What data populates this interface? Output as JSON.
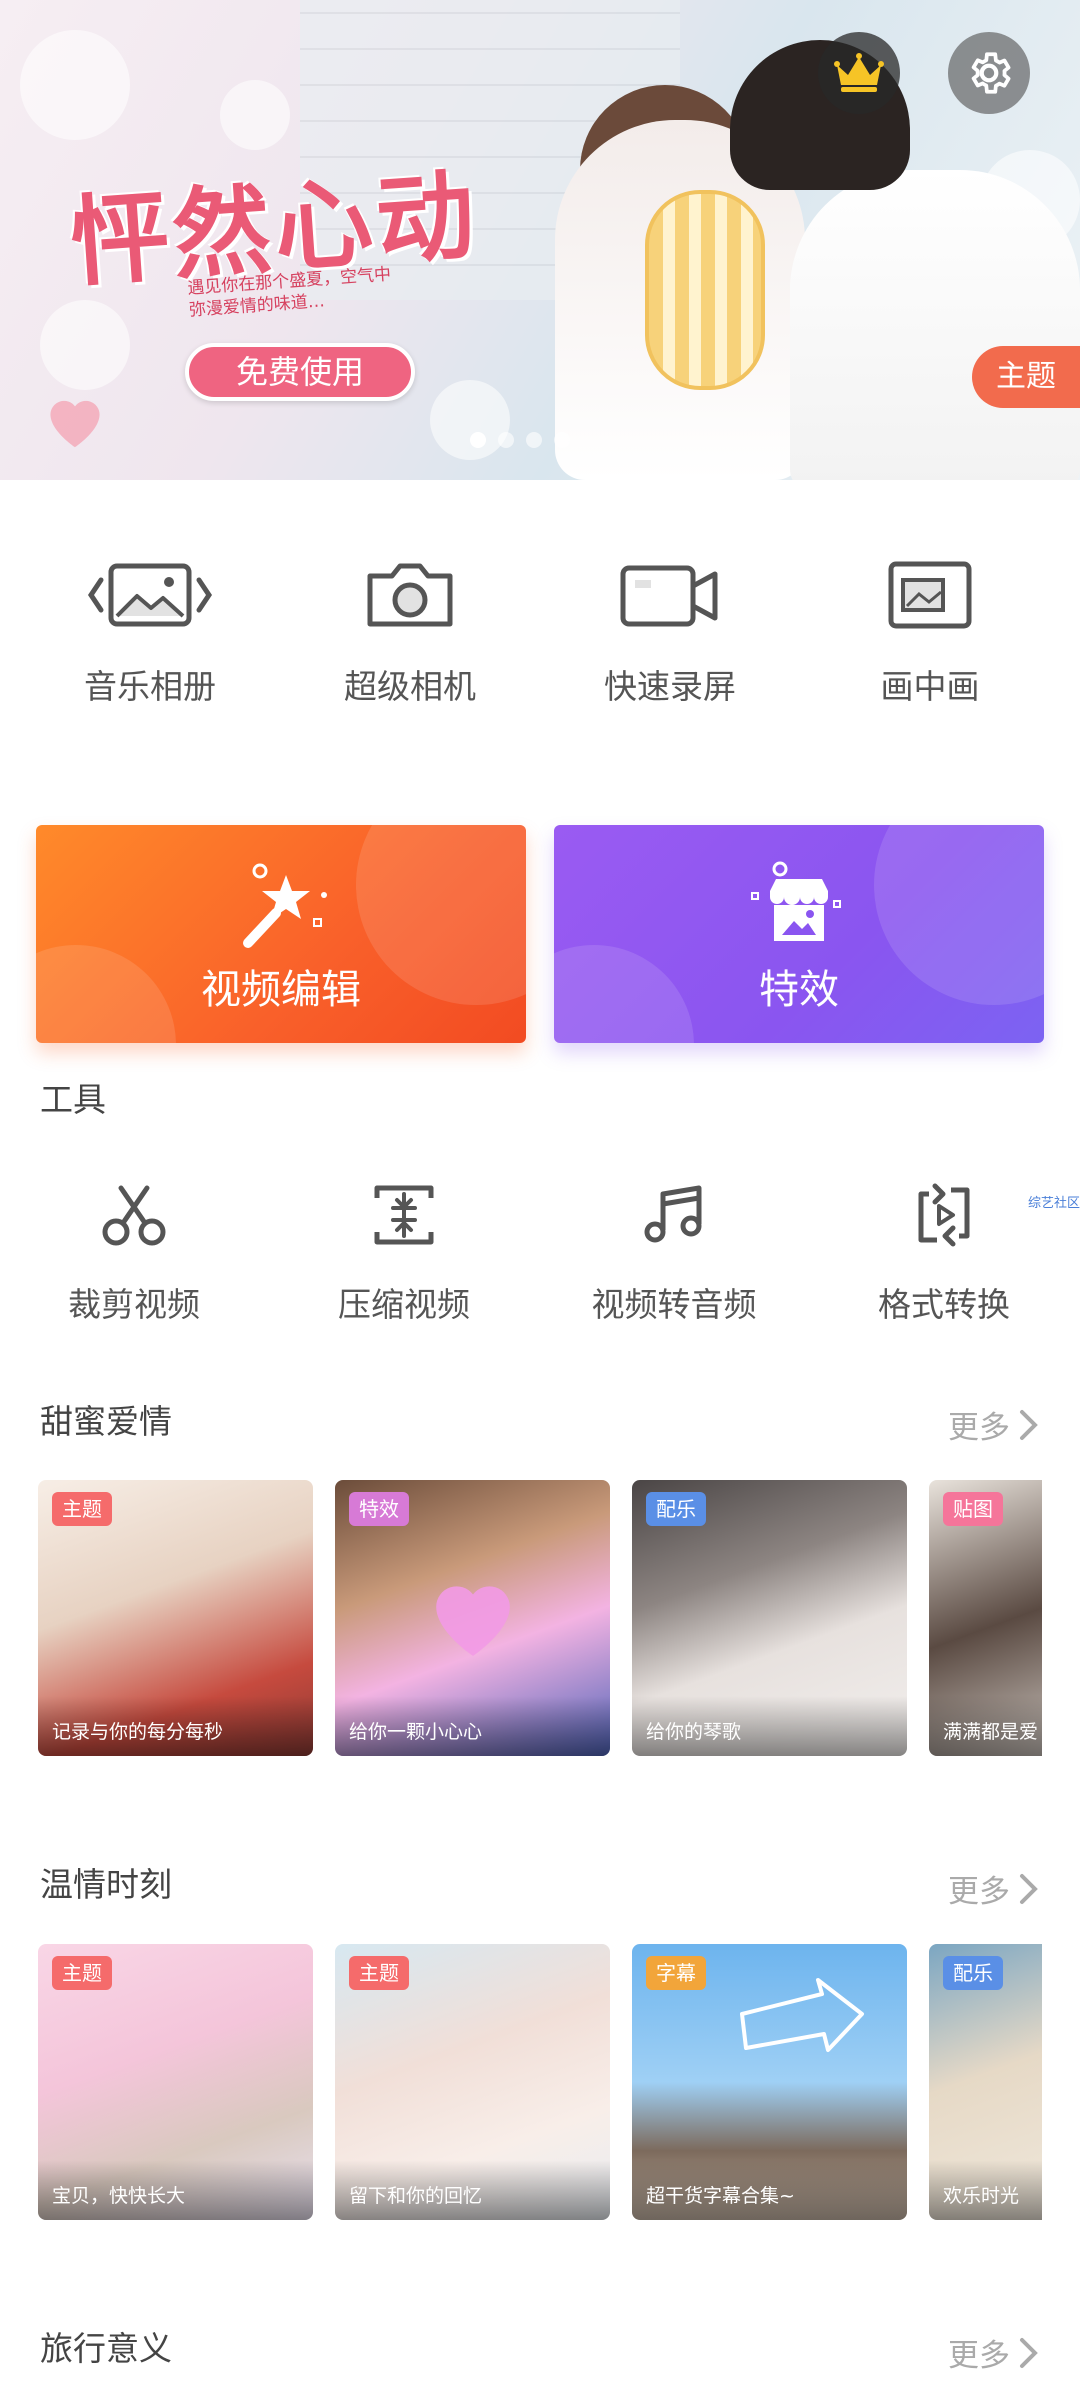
{
  "banner": {
    "title": "怦然心动",
    "subtitle": "遇见你在那个盛夏，空气中弥漫爱情的味道…",
    "free_button": "免费使用",
    "tag": "主题",
    "crown_icon": "crown-icon",
    "settings_icon": "gear-icon",
    "dots": 4,
    "active_dot": 0
  },
  "quick_tools": [
    {
      "label": "音乐相册",
      "icon": "photo-album-icon"
    },
    {
      "label": "超级相机",
      "icon": "camera-icon"
    },
    {
      "label": "快速录屏",
      "icon": "screen-record-icon"
    },
    {
      "label": "画中画",
      "icon": "picture-in-picture-icon"
    }
  ],
  "cards": [
    {
      "label": "视频编辑",
      "icon": "magic-wand-icon"
    },
    {
      "label": "特效",
      "icon": "effects-store-icon"
    }
  ],
  "tools": {
    "title": "工具",
    "items": [
      {
        "label": "裁剪视频",
        "icon": "scissors-icon"
      },
      {
        "label": "压缩视频",
        "icon": "compress-icon"
      },
      {
        "label": "视频转音频",
        "icon": "music-note-icon"
      },
      {
        "label": "格式转换",
        "icon": "convert-icon"
      }
    ],
    "watermark": "综艺社区"
  },
  "sections": [
    {
      "title": "甜蜜爱情",
      "more": "更多",
      "templates": [
        {
          "tag": "主题",
          "caption": "记录与你的每分每秒"
        },
        {
          "tag": "特效",
          "caption": "给你一颗小心心"
        },
        {
          "tag": "配乐",
          "caption": "给你的琴歌"
        },
        {
          "tag": "贴图",
          "caption": "满满都是爱"
        }
      ]
    },
    {
      "title": "温情时刻",
      "more": "更多",
      "templates": [
        {
          "tag": "主题",
          "caption": "宝贝，快快长大"
        },
        {
          "tag": "主题",
          "caption": "留下和你的回忆"
        },
        {
          "tag": "字幕",
          "caption": "超干货字幕合集~"
        },
        {
          "tag": "配乐",
          "caption": "欢乐时光"
        }
      ]
    },
    {
      "title": "旅行意义",
      "more": "更多"
    }
  ]
}
